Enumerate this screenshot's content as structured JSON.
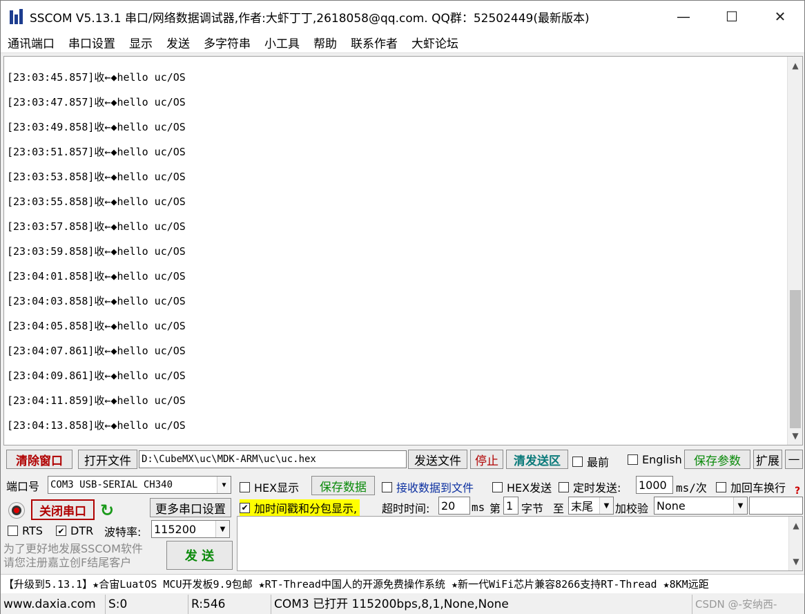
{
  "window": {
    "title": "SSCOM V5.13.1 串口/网络数据调试器,作者:大虾丁丁,2618058@qq.com. QQ群：52502449(最新版本)"
  },
  "menu": [
    "通讯端口",
    "串口设置",
    "显示",
    "发送",
    "多字符串",
    "小工具",
    "帮助",
    "联系作者",
    "大虾论坛"
  ],
  "receive": {
    "lines": [
      "[23:03:45.857]收←◆hello uc/OS",
      "[23:03:47.857]收←◆hello uc/OS",
      "[23:03:49.858]收←◆hello uc/OS",
      "[23:03:51.857]收←◆hello uc/OS",
      "[23:03:53.858]收←◆hello uc/OS",
      "[23:03:55.858]收←◆hello uc/OS",
      "[23:03:57.858]收←◆hello uc/OS",
      "[23:03:59.858]收←◆hello uc/OS",
      "[23:04:01.858]收←◆hello uc/OS",
      "[23:04:03.858]收←◆hello uc/OS",
      "[23:04:05.858]收←◆hello uc/OS",
      "[23:04:07.861]收←◆hello uc/OS",
      "[23:04:09.861]收←◆hello uc/OS",
      "[23:04:11.859]收←◆hello uc/OS",
      "[23:04:13.858]收←◆hello uc/OS"
    ]
  },
  "toolbar": {
    "clear_window": "清除窗口",
    "open_file": "打开文件",
    "file_path": "D:\\CubeMX\\uc\\MDK-ARM\\uc\\uc.hex",
    "send_file": "发送文件",
    "stop": "停止",
    "clear_send": "清发送区",
    "top_most": "最前",
    "english": "English",
    "save_params": "保存参数",
    "expand": "扩展",
    "collapse": "—"
  },
  "port": {
    "port_label": "端口号",
    "port_value": "COM3 USB-SERIAL CH340",
    "close_port": "关闭串口",
    "more_settings": "更多串口设置",
    "rts": "RTS",
    "dtr": "DTR",
    "baud_label": "波特率:",
    "baud_value": "115200"
  },
  "options": {
    "hex_display": "HEX显示",
    "save_data": "保存数据",
    "recv_to_file": "接收数据到文件",
    "hex_send": "HEX发送",
    "timed_send": "定时发送:",
    "interval": "1000",
    "interval_unit": "ms/次",
    "add_crlf": "加回车换行",
    "timestamp": "加时间戳和分包显示,",
    "timeout_label": "超时时间:",
    "timeout_value": "20",
    "timeout_unit": "ms",
    "nth_label": "第",
    "nth_value": "1",
    "byte_label": "字节",
    "to_label": "至",
    "end_value": "末尾",
    "checksum_label": "加校验",
    "checksum_value": "None"
  },
  "promo": {
    "line1": "为了更好地发展SSCOM软件",
    "line2": "请您注册嘉立创F结尾客户"
  },
  "send_button": "发  送",
  "ticker": "【升级到5.13.1】★合宙LuatOS MCU开发板9.9包邮 ★RT-Thread中国人的开源免费操作系统 ★新一代WiFi芯片兼容8266支持RT-Thread ★8KM远距",
  "status": {
    "website": "www.daxia.com",
    "sent": "S:0",
    "received": "R:546",
    "port_state": "COM3 已打开  115200bps,8,1,None,None",
    "watermark": "CSDN @-安纳西-"
  }
}
